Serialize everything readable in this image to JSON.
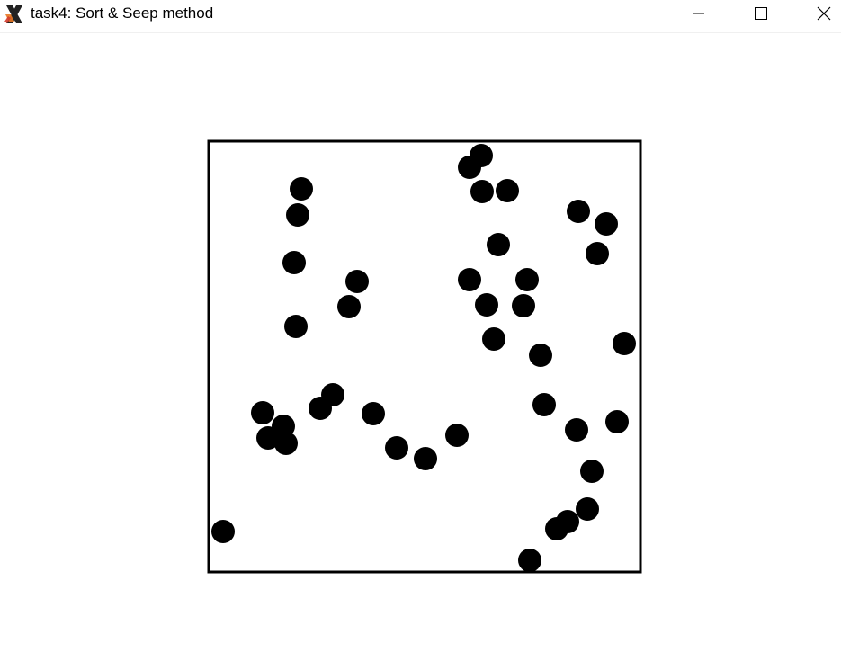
{
  "window": {
    "title": "task4: Sort & Seep method",
    "app_icon": "x-logo-icon",
    "controls": {
      "minimize_icon": "minimize-icon",
      "maximize_icon": "maximize-icon",
      "close_icon": "close-icon"
    }
  },
  "scene": {
    "box_color": "#000000",
    "ball_color": "#000000",
    "background_color": "#ffffff"
  }
}
